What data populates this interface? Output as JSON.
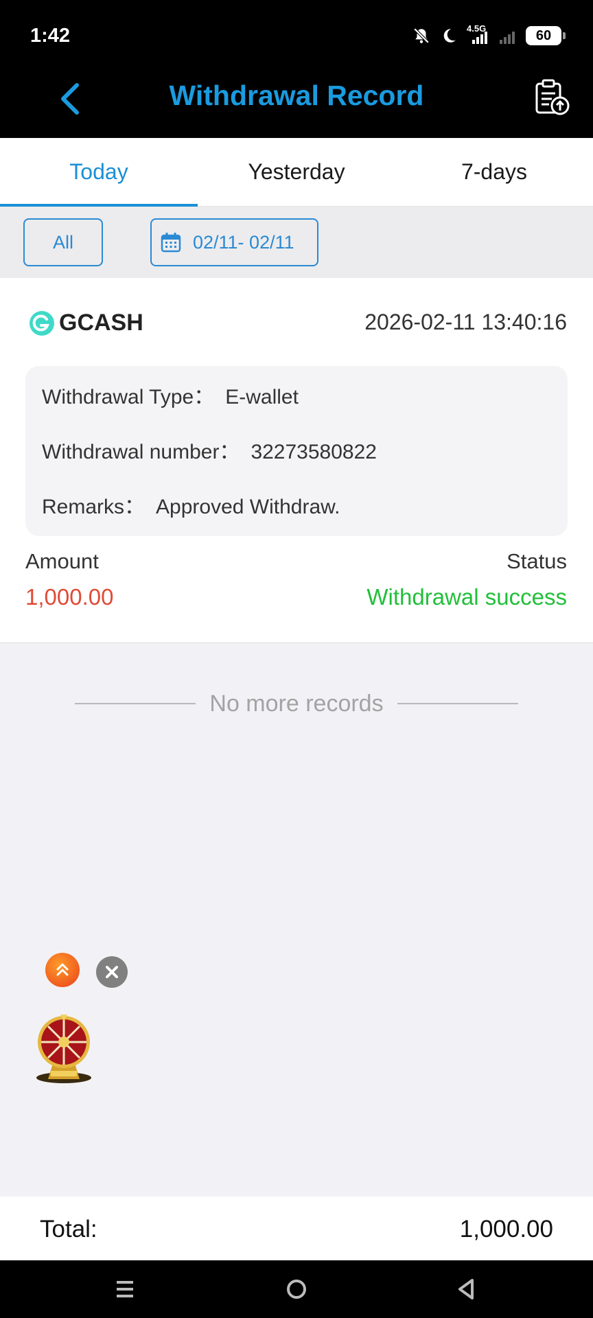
{
  "status_bar": {
    "time": "1:42",
    "network": "4.5G",
    "battery": "60"
  },
  "header": {
    "title": "Withdrawal Record"
  },
  "tabs": [
    {
      "label": "Today",
      "active": true
    },
    {
      "label": "Yesterday",
      "active": false
    },
    {
      "label": "7-days",
      "active": false
    }
  ],
  "filter": {
    "type_label": "All",
    "date_range": "02/11- 02/11"
  },
  "record": {
    "provider": "GCASH",
    "datetime": "2026-02-11 13:40:16",
    "details": {
      "type_label": "Withdrawal Type：",
      "type_value": "E-wallet",
      "number_label": "Withdrawal number：",
      "number_value": "32273580822",
      "remarks_label": "Remarks：",
      "remarks_value": "Approved Withdraw."
    },
    "amount_label": "Amount",
    "amount_value": "1,000.00",
    "status_label": "Status",
    "status_value": "Withdrawal success"
  },
  "list_end_text": "No more records",
  "total": {
    "label": "Total:",
    "value": "1,000.00"
  },
  "colors": {
    "accent": "#1a9be0",
    "amount": "#e04b36",
    "success": "#21bf3a",
    "background": "#f2f2f6"
  },
  "icons": [
    "back-arrow-icon",
    "export-clipboard-icon",
    "calendar-icon",
    "gcash-logo-icon",
    "scroll-top-icon",
    "close-icon",
    "lucky-wheel-icon",
    "menu-icon",
    "home-icon",
    "back-triangle-icon",
    "mute-bell-icon",
    "moon-icon",
    "signal-icon",
    "battery-icon"
  ]
}
